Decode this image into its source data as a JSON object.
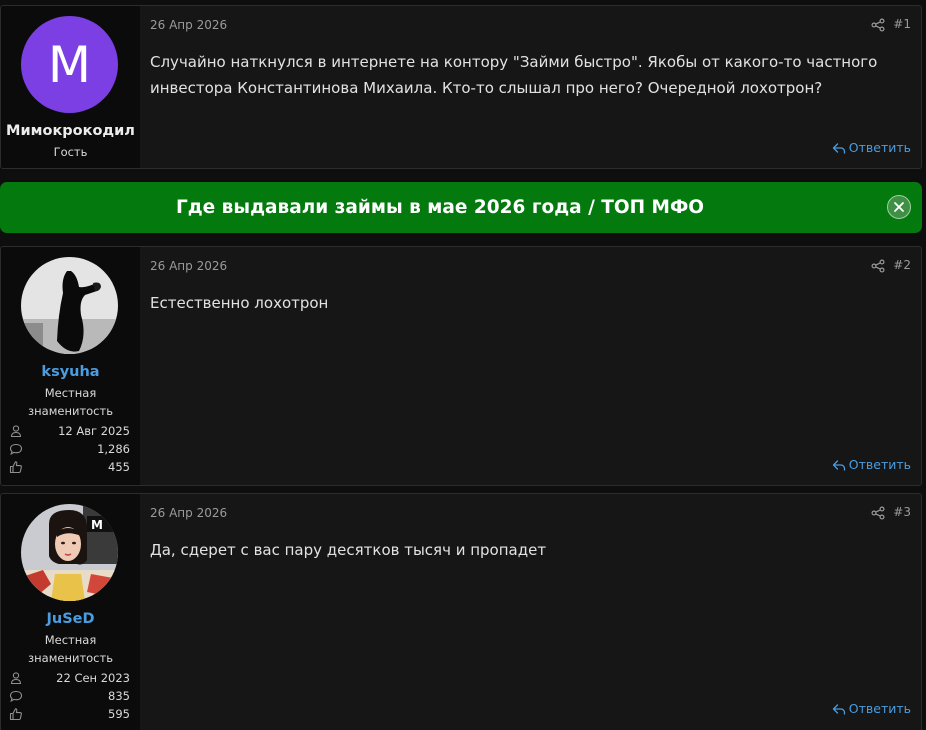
{
  "posts": [
    {
      "username": "Мимокрокодил",
      "user_title": "Гость",
      "avatar_letter": "M",
      "date": "26 Апр 2026",
      "number": "#1",
      "message": "Случайно наткнулся в интернете на контору \"Займи быстро\". Якобы от какого-то частного инвестора Константинова Михаила. Кто-то слышал про него? Очередной лохотрон?",
      "reply_label": "Ответить"
    },
    {
      "username": "ksyuha",
      "user_title": "Местная знаменитость",
      "joined": "12 Авг 2025",
      "messages": "1,286",
      "reactions": "455",
      "date": "26 Апр 2026",
      "number": "#2",
      "message": "Естественно лохотрон",
      "reply_label": "Ответить"
    },
    {
      "username": "JuSeD",
      "user_title": "Местная знаменитость",
      "joined": "22 Сен 2023",
      "messages": "835",
      "reactions": "595",
      "date": "26 Апр 2026",
      "number": "#3",
      "message": "Да, сдерет с вас пару десятков тысяч и пропадет",
      "reply_label": "Ответить"
    }
  ],
  "banner": {
    "text": "Где выдавали займы в мае 2026 года / ТОП МФО"
  },
  "icons": {
    "share": "share-icon",
    "reply": "reply-arrow-icon",
    "user": "user-icon",
    "messages": "speech-bubble-icon",
    "reactions": "thumbs-up-icon",
    "close": "close-icon"
  },
  "colors": {
    "page_bg": "#0e0e0e",
    "post_bg": "#161616",
    "user_col_bg": "#0b0b0b",
    "accent_link": "#4a9de0",
    "banner_bg": "#047a0e",
    "guest_avatar_bg": "#7b3fe4"
  }
}
